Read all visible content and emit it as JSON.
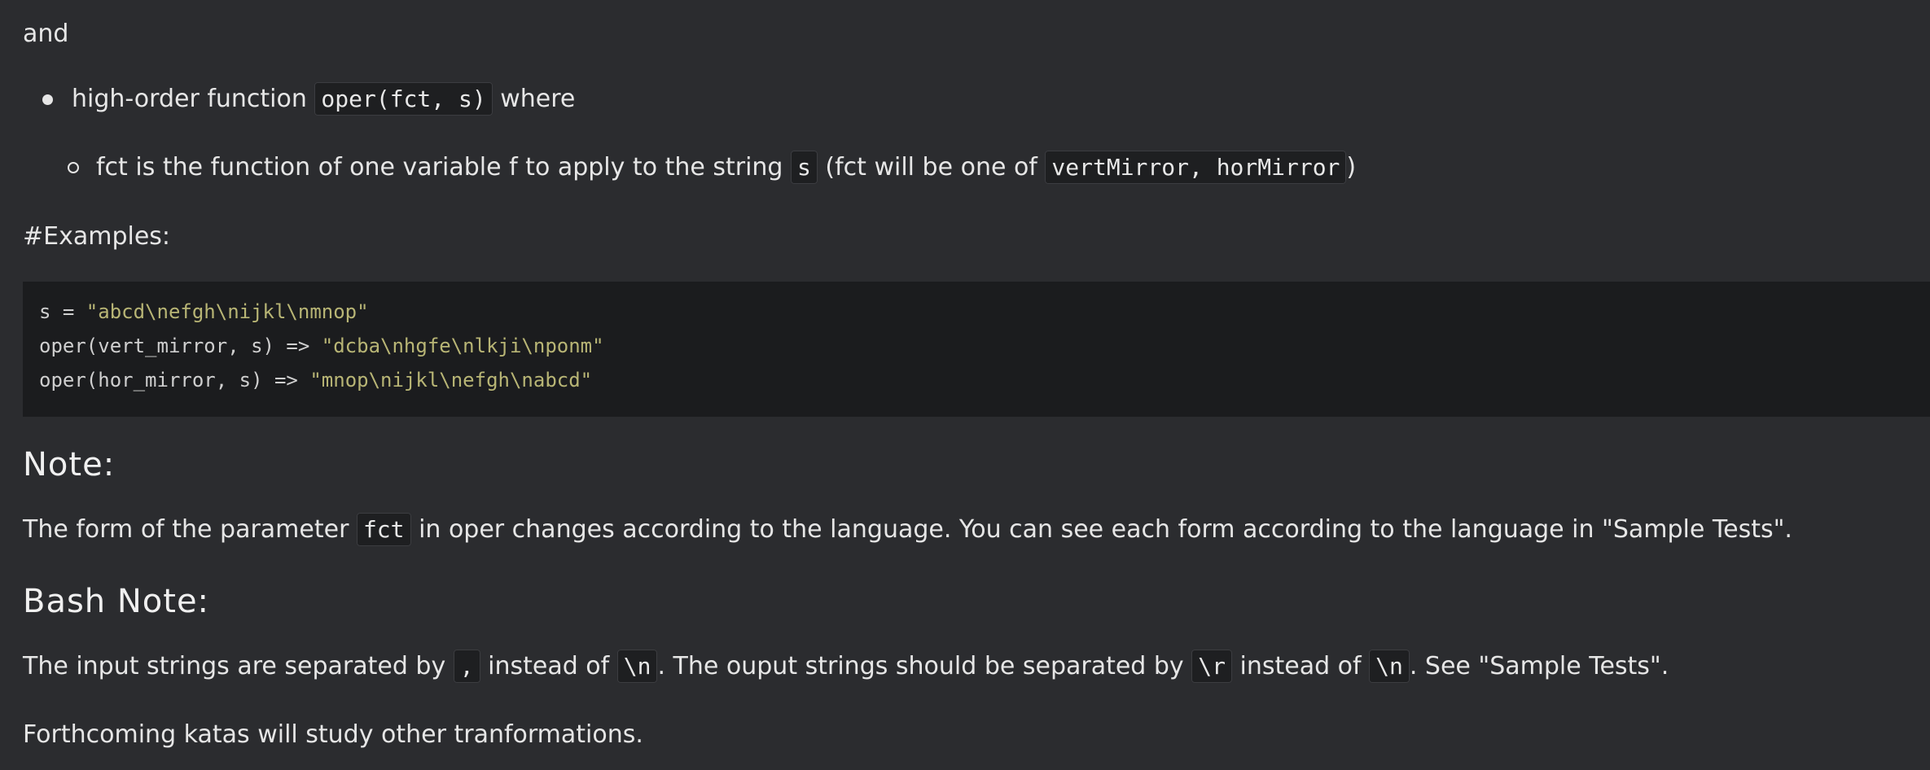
{
  "intro": {
    "and_text": "and"
  },
  "bullets": {
    "b1_prefix": "high-order function ",
    "b1_code": "oper(fct, s)",
    "b1_suffix": " where",
    "b2_prefix": "fct is the function of one variable f to apply to the string ",
    "b2_code1": "s",
    "b2_middle": " (fct will be one of ",
    "b2_code2": "vertMirror, horMirror",
    "b2_suffix": ")"
  },
  "examples": {
    "heading": "#Examples:",
    "line1_plain": "s = ",
    "line1_string": "\"abcd\\nefgh\\nijkl\\nmnop\"",
    "line2_plain": "oper(vert_mirror, s) => ",
    "line2_string": "\"dcba\\nhgfe\\nlkji\\nponm\"",
    "line3_plain": "oper(hor_mirror, s) => ",
    "line3_string": "\"mnop\\nijkl\\nefgh\\nabcd\""
  },
  "note": {
    "heading": "Note:",
    "prefix": "The form of the parameter ",
    "code": "fct",
    "suffix": " in oper changes according to the language. You can see each form according to the language in \"Sample Tests\"."
  },
  "bash_note": {
    "heading": "Bash Note:",
    "t1": "The input strings are separated by ",
    "c1": ",",
    "t2": " instead of ",
    "c2": "\\n",
    "t3": ". The ouput strings should be separated by ",
    "c3": "\\r",
    "t4": " instead of ",
    "c4": "\\n",
    "t5": ". See \"Sample Tests\"."
  },
  "footer": {
    "text": "Forthcoming katas will study other tranformations."
  },
  "colors": {
    "background": "#2b2c2f",
    "code_background": "#1b1c1e",
    "string_color": "#b8b575",
    "text_color": "#e6e6e6"
  }
}
